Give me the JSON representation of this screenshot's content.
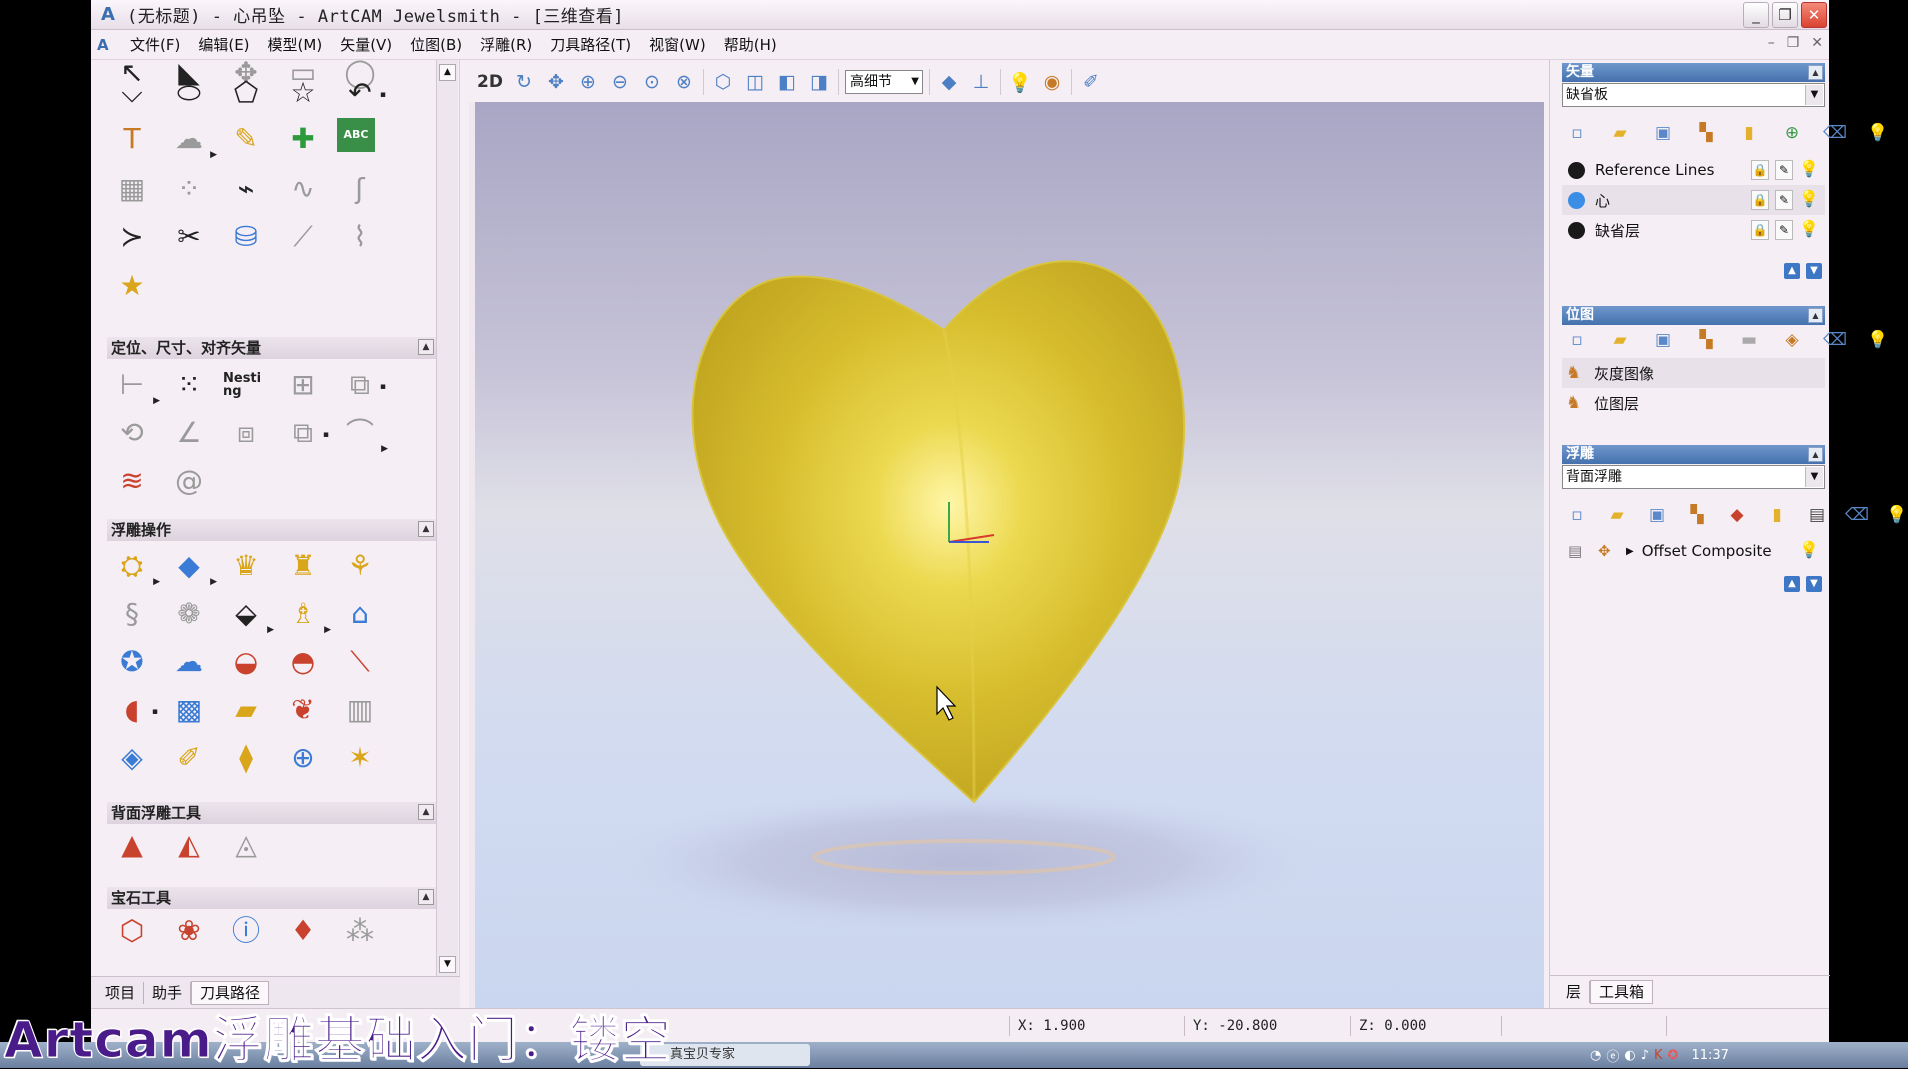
{
  "window": {
    "title": "(无标题) - 心吊坠 - ArtCAM Jewelsmith - [三维查看]",
    "buttons": [
      "_",
      "❐",
      "✕"
    ]
  },
  "menubar": {
    "items": [
      "文件(F)",
      "编辑(E)",
      "模型(M)",
      "矢量(V)",
      "位图(B)",
      "浮雕(R)",
      "刀具路径(T)",
      "视窗(W)",
      "帮助(H)"
    ]
  },
  "left_panel": {
    "sections": [
      "定位、尺寸、对齐矢量",
      "浮雕操作",
      "背面浮雕工具",
      "宝石工具"
    ],
    "nesting_icon_text": "Nesting",
    "abc_icon_text": "ABC",
    "tabs": [
      "项目",
      "助手",
      "刀具路径"
    ]
  },
  "view_toolbar": {
    "mode_2d": "2D",
    "detail_select": "高细节"
  },
  "right_panel": {
    "vector_header": "矢量",
    "vector_sheet": "缺省板",
    "layers": [
      {
        "name": "Reference Lines",
        "color": "#1a1a1a",
        "selected": false
      },
      {
        "name": "心",
        "color": "#3b8ee6",
        "selected": true
      },
      {
        "name": "缺省层",
        "color": "#1a1a1a",
        "selected": false
      }
    ],
    "bitmap_header": "位图",
    "bitmaps": [
      {
        "name": "灰度图像",
        "selected": true
      },
      {
        "name": "位图层",
        "selected": false
      }
    ],
    "relief_header": "浮雕",
    "relief_select": "背面浮雕",
    "relief_item": "Offset Composite",
    "tabs": [
      "层",
      "工具箱"
    ]
  },
  "statusbar": {
    "x": "X: 1.900",
    "y": "Y: -20.800",
    "z": "Z: 0.000"
  },
  "taskbar": {
    "item": "真宝贝专家",
    "clock": "11:37"
  },
  "caption": "Artcam浮雕基础入门：镂空",
  "colors": {
    "heart": "#e8d44a",
    "panel_header": "#4a78b4",
    "caption": "#4a1c8a"
  }
}
